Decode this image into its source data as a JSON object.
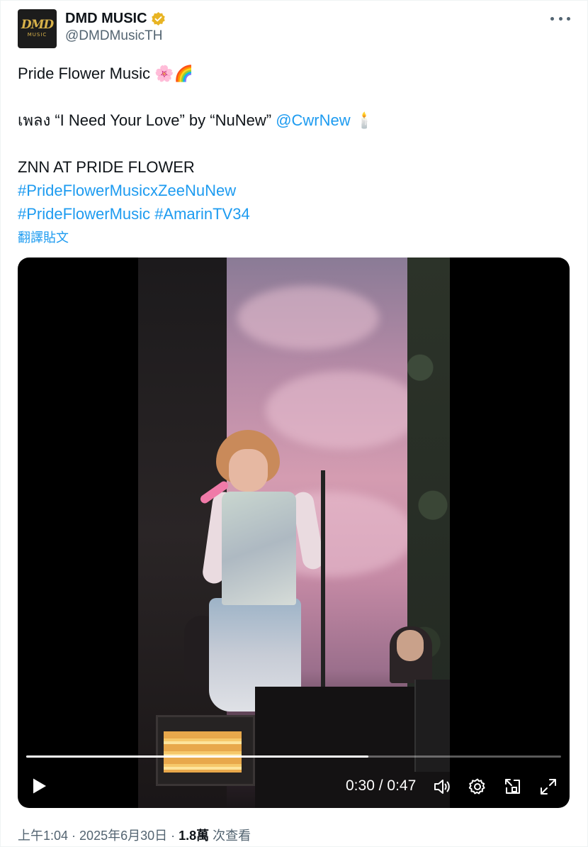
{
  "author": {
    "display_name": "DMD MUSIC",
    "handle": "@DMDMusicTH",
    "avatar_text": "DMD",
    "avatar_subtext": "MUSIC",
    "verified_color": "#e8b423"
  },
  "tweet": {
    "line1_text": "Pride Flower Music",
    "line1_emoji": "🌸🌈",
    "line2_prefix": "เพลง “I Need Your Love” by “NuNew”",
    "line2_mention": "@CwrNew",
    "line2_emoji": "🕯️",
    "line3": "ZNN AT PRIDE FLOWER",
    "hashtag1": "#PrideFlowerMusicxZeeNuNew",
    "hashtag2": "#PrideFlowerMusic",
    "hashtag3": "#AmarinTV34",
    "translate_label": "翻譯貼文"
  },
  "video": {
    "current_time": "0:30",
    "separator": " / ",
    "duration": "0:47",
    "progress_fraction": 0.64
  },
  "footer": {
    "time": "上午1:04",
    "sep1": " · ",
    "date": "2025年6月30日",
    "sep2": " · ",
    "views": "1.8萬",
    "views_label": " 次查看"
  },
  "colors": {
    "link": "#1d9bf0",
    "secondary_text": "#536471"
  }
}
